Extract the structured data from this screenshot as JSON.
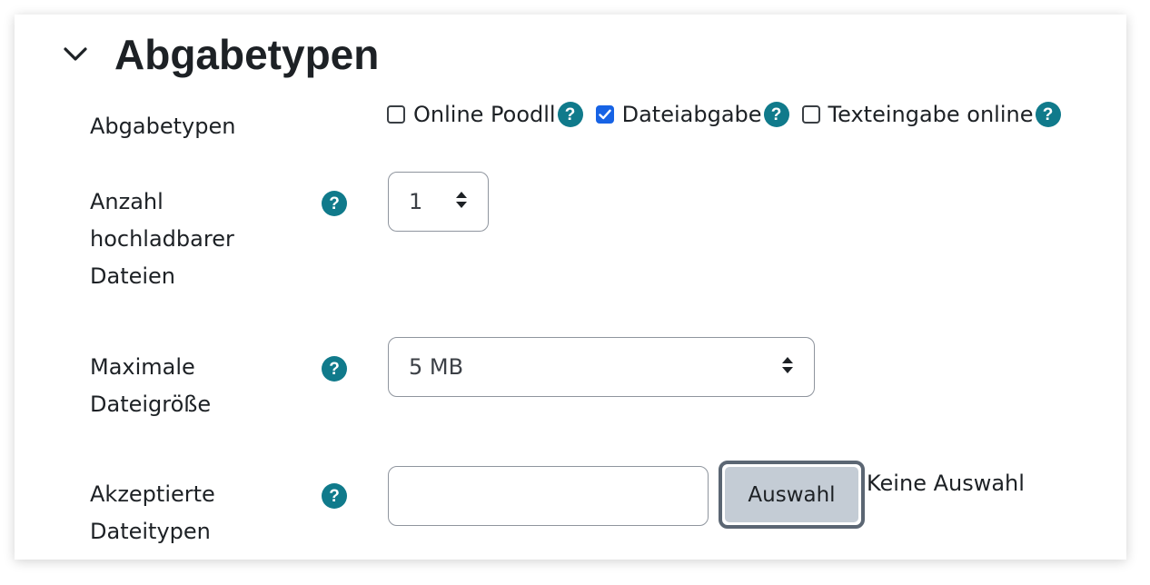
{
  "section": {
    "title": "Abgabetypen",
    "chevron_icon": "chevron-down-icon"
  },
  "submission_types": {
    "label": "Abgabetypen",
    "options": [
      {
        "label": "Online Poodll",
        "checked": false
      },
      {
        "label": "Dateiabgabe",
        "checked": true
      },
      {
        "label": "Texteingabe online",
        "checked": false
      }
    ]
  },
  "max_files": {
    "label_lines": [
      "Anzahl",
      "hochladbarer",
      "Dateien"
    ],
    "value": "1"
  },
  "max_size": {
    "label_lines": [
      "Maximale",
      "Dateigröße"
    ],
    "value": "5 MB"
  },
  "accepted_types": {
    "label_lines": [
      "Akzeptierte",
      "Dateitypen"
    ],
    "input_value": "",
    "button_label": "Auswahl",
    "status_text": "Keine Auswahl"
  },
  "help_glyph": "?",
  "colors": {
    "help_icon": "#107a8b",
    "checkbox_checked": "#1763e5",
    "button_bg": "#c4ccd5",
    "button_focus_ring": "#5b6673"
  }
}
